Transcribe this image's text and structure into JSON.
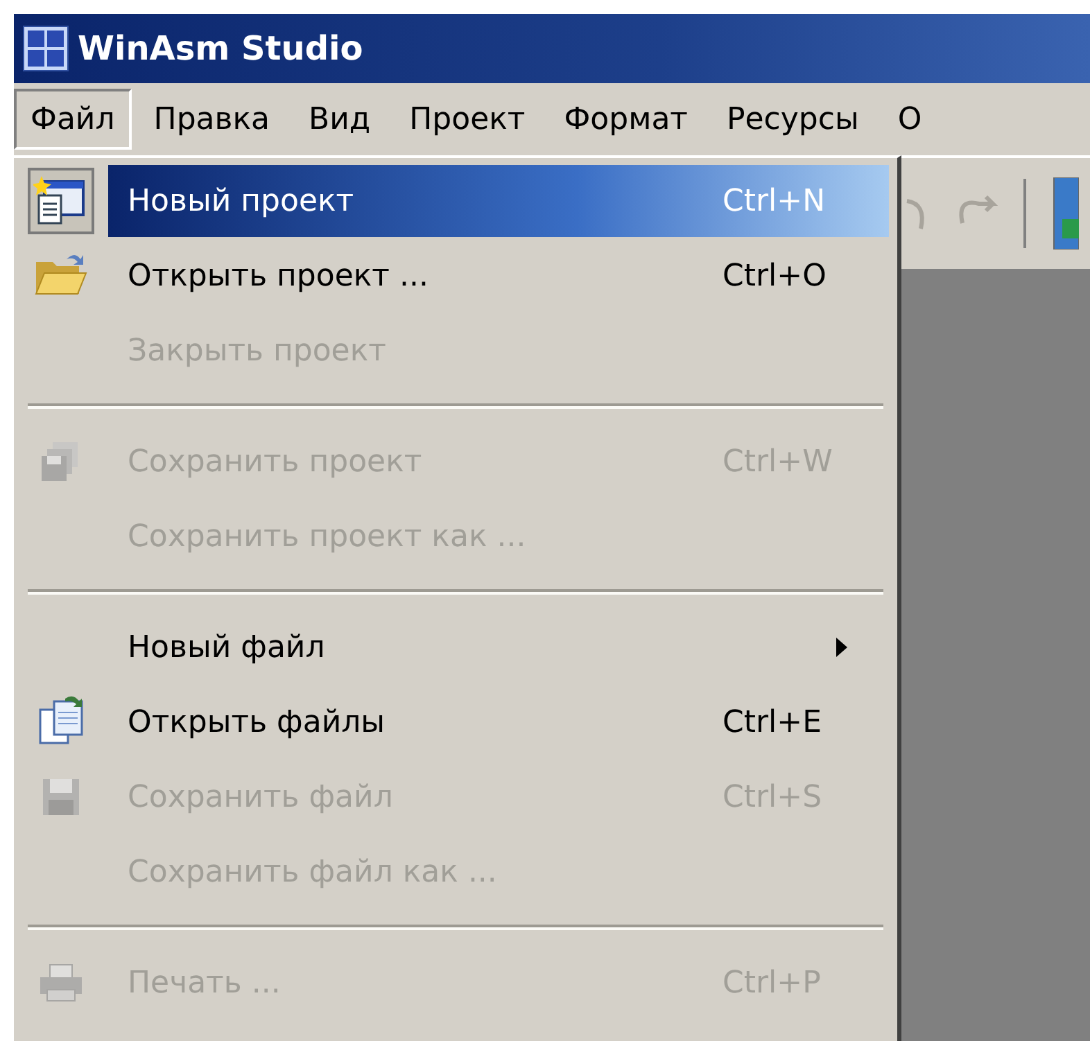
{
  "window": {
    "title": "WinAsm Studio"
  },
  "menu_bar": [
    {
      "label": "Файл",
      "selected": true
    },
    {
      "label": "Правка",
      "selected": false
    },
    {
      "label": "Вид",
      "selected": false
    },
    {
      "label": "Проект",
      "selected": false
    },
    {
      "label": "Формат",
      "selected": false
    },
    {
      "label": "Ресурсы",
      "selected": false
    },
    {
      "label": "О",
      "selected": false
    }
  ],
  "file_menu": [
    {
      "kind": "item",
      "label": "Новый проект",
      "shortcut": "Ctrl+N",
      "disabled": false,
      "selected": true
    },
    {
      "kind": "item",
      "label": "Открыть проект ...",
      "shortcut": "Ctrl+O",
      "disabled": false,
      "selected": false
    },
    {
      "kind": "item",
      "label": "Закрыть проект",
      "disabled": true,
      "selected": false
    },
    {
      "kind": "separator"
    },
    {
      "kind": "item",
      "label": "Сохранить проект",
      "shortcut": "Ctrl+W",
      "disabled": true,
      "selected": false
    },
    {
      "kind": "item",
      "label": "Сохранить проект как ...",
      "disabled": true,
      "selected": false
    },
    {
      "kind": "separator"
    },
    {
      "kind": "submenu",
      "label": "Новый файл",
      "disabled": false,
      "selected": false
    },
    {
      "kind": "item",
      "label": "Открыть файлы",
      "shortcut": "Ctrl+E",
      "disabled": false,
      "selected": false
    },
    {
      "kind": "item",
      "label": "Сохранить файл",
      "shortcut": "Ctrl+S",
      "disabled": true,
      "selected": false
    },
    {
      "kind": "item",
      "label": "Сохранить файл как ...",
      "disabled": true,
      "selected": false
    },
    {
      "kind": "separator"
    },
    {
      "kind": "item",
      "label": "Печать ...",
      "shortcut": "Ctrl+P",
      "disabled": true,
      "selected": false
    }
  ]
}
